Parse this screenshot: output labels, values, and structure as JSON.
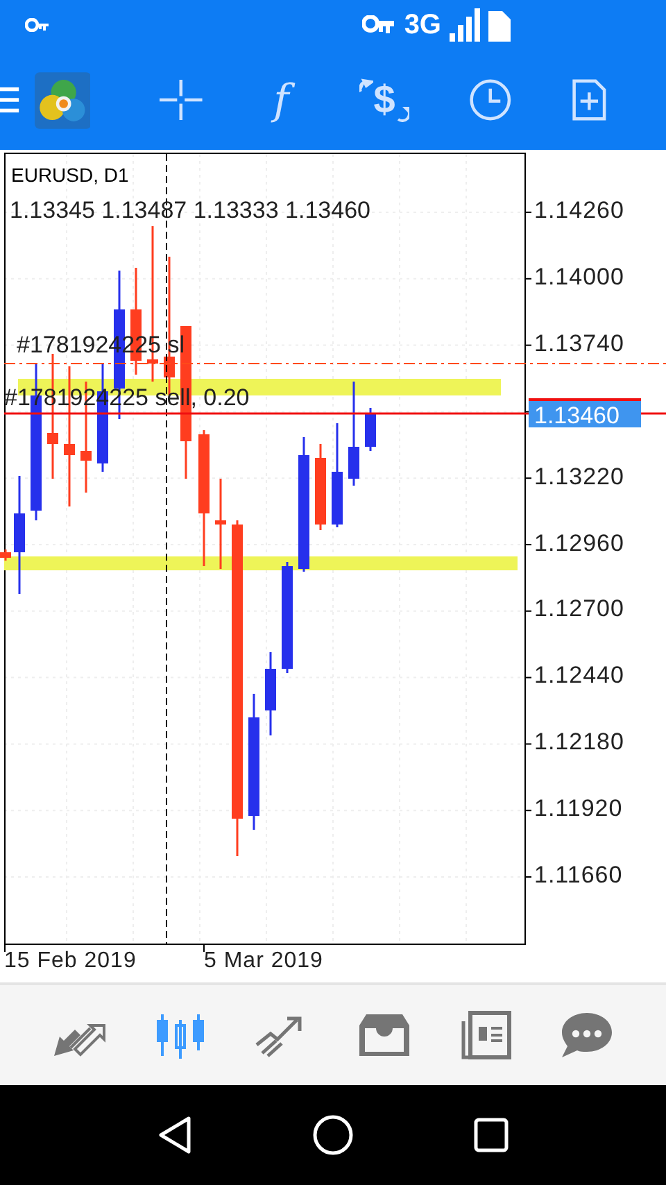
{
  "status_bar": {
    "network": "3G"
  },
  "toolbar": {
    "function_glyph": "f",
    "currency_glyph": "$"
  },
  "chart": {
    "symbol": "EURUSD, D1",
    "ohlc": "1.13345 1.13487 1.13333 1.13460",
    "price_ticks": [
      "1.14260",
      "1.14000",
      "1.13740",
      "1.13220",
      "1.12960",
      "1.12700",
      "1.12440",
      "1.12180",
      "1.11920",
      "1.11660"
    ],
    "current_price": "1.13460",
    "orders": [
      {
        "label": "#1781924225 sl"
      },
      {
        "label": "#1781924225 sell, 0.20"
      }
    ],
    "dates": [
      "15 Feb 2019",
      "5 Mar 2019"
    ]
  },
  "bottom_nav": [
    {
      "kind": "quotes",
      "selected": false
    },
    {
      "kind": "chart",
      "selected": true
    },
    {
      "kind": "trade",
      "selected": false
    },
    {
      "kind": "history",
      "selected": false
    },
    {
      "kind": "news",
      "selected": false
    },
    {
      "kind": "chat",
      "selected": false
    }
  ]
}
